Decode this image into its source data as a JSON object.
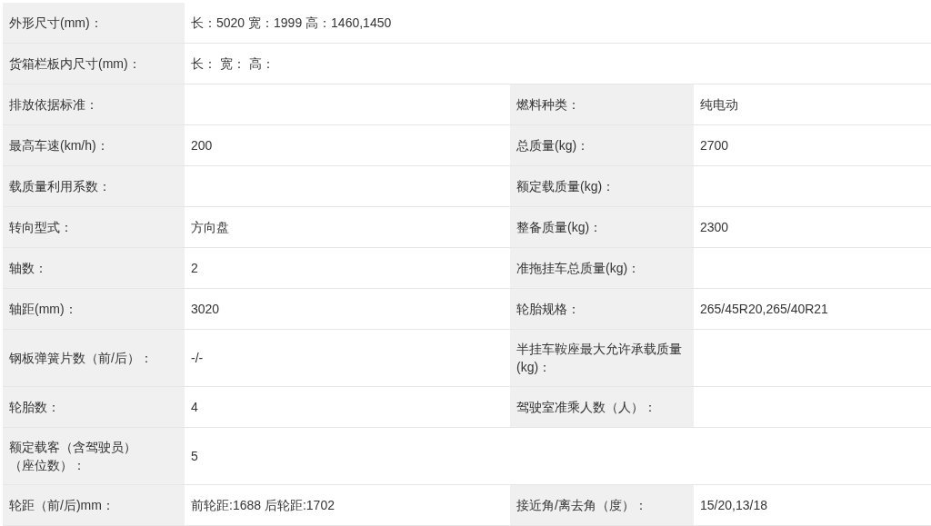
{
  "rows": [
    {
      "label": "外形尺寸(mm)：",
      "value": "长：5020 宽：1999 高：1460,1450"
    },
    {
      "label": "货箱栏板内尺寸(mm)：",
      "value": "长：  宽：  高："
    },
    {
      "label": "排放依据标准：",
      "label_2": "燃料种类：",
      "value_2": "纯电动"
    },
    {
      "label": "最高车速(km/h)：",
      "value": "200",
      "label_2": "总质量(kg)：",
      "value_2": "2700"
    },
    {
      "label": "载质量利用系数：",
      "label_2": "额定载质量(kg)："
    },
    {
      "label": "转向型式：",
      "value": "方向盘",
      "label_2": "整备质量(kg)：",
      "value_2": "2300"
    },
    {
      "label": "轴数：",
      "value": "2",
      "label_2": "准拖挂车总质量(kg)："
    },
    {
      "label": "轴距(mm)：",
      "value": "3020",
      "label_2": "轮胎规格：",
      "value_2": "265/45R20,265/40R21"
    },
    {
      "label": "钢板弹簧片数（前/后）：",
      "value": "-/-",
      "label_2": "半挂车鞍座最大允许承载质量(kg)："
    },
    {
      "label": "轮胎数：",
      "value": "4",
      "label_2": "驾驶室准乘人数（人）："
    },
    {
      "label": "额定载客（含驾驶员）（座位数）：",
      "value": "5"
    },
    {
      "label": "轮距（前/后)mm：",
      "value": "前轮距:1688 后轮距:1702",
      "label_2": "接近角/离去角（度）：",
      "value_2": "15/20,13/18"
    }
  ]
}
